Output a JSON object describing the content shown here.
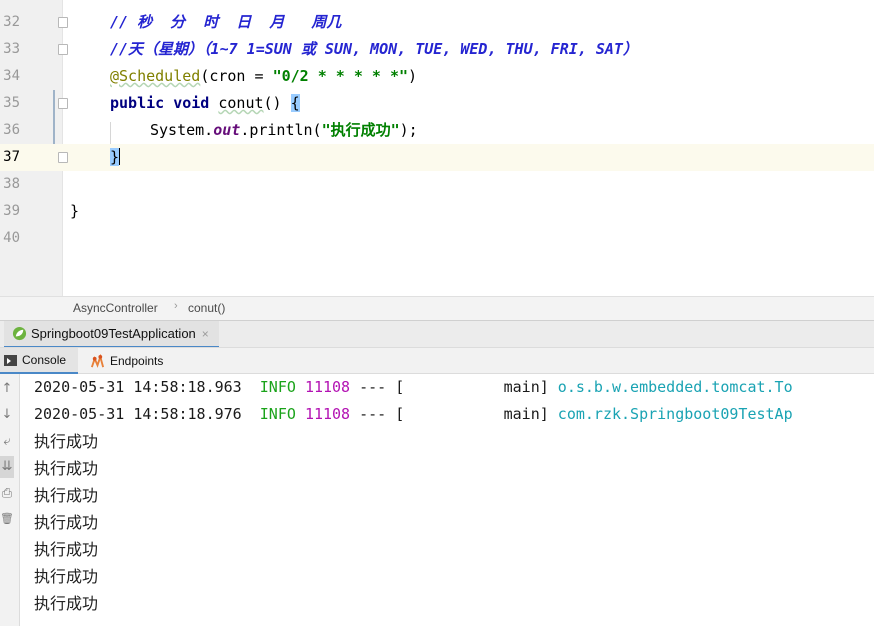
{
  "editor": {
    "lines": [
      {
        "num": "32",
        "comment": "// 秒  分  时  日  月   周几"
      },
      {
        "num": "33",
        "comment": "//天（星期）（1~7 1=SUN 或 SUN, MON, TUE, WED, THU, FRI, SAT）"
      },
      {
        "num": "34",
        "annotation": "@Scheduled",
        "open": "(cron = ",
        "value": "\"0/2 * * * * *\"",
        "close": ")"
      },
      {
        "num": "35",
        "kw1": "public",
        "kw2": "void",
        "method": "conut",
        "rest": "() ",
        "brace": "{"
      },
      {
        "num": "36",
        "receiver": "System.",
        "field": "out",
        "call": ".println(",
        "arg": "\"执行成功\"",
        "tail": ");"
      },
      {
        "num": "37",
        "brace": "}"
      },
      {
        "num": "38"
      },
      {
        "num": "39",
        "brace": "}"
      },
      {
        "num": "40"
      }
    ]
  },
  "breadcrumb": {
    "class": "AsyncController",
    "separator": "›",
    "method": "conut()"
  },
  "run_window": {
    "tab_label": "Springboot09TestApplication",
    "tab_close": "×",
    "subtabs": {
      "console": "Console",
      "endpoints": "Endpoints"
    }
  },
  "toolbar": {
    "up_icon": "↑",
    "down_icon": "↓",
    "wrap_icon": "⤶",
    "scroll_end_icon": "⇊",
    "print_icon": "⎙",
    "trash_icon": "🗑"
  },
  "console": {
    "logs": [
      {
        "time": "2020-05-31 14:58:18.963",
        "level": "INFO",
        "pid": "11108",
        "sep": " --- [",
        "thread": "           main]",
        "logger": " o.s.b.w.embedded.tomcat.To"
      },
      {
        "time": "2020-05-31 14:58:18.976",
        "level": "INFO",
        "pid": "11108",
        "sep": " --- [",
        "thread": "           main]",
        "logger": " com.rzk.Springboot09TestAp"
      }
    ],
    "outputs": [
      "执行成功",
      "执行成功",
      "执行成功",
      "执行成功",
      "执行成功",
      "执行成功",
      "执行成功"
    ]
  },
  "colors": {
    "accent": "#4a88c7",
    "keyword": "#000080",
    "string": "#008000",
    "comment": "#2525d1",
    "info": "#1aa31a"
  }
}
